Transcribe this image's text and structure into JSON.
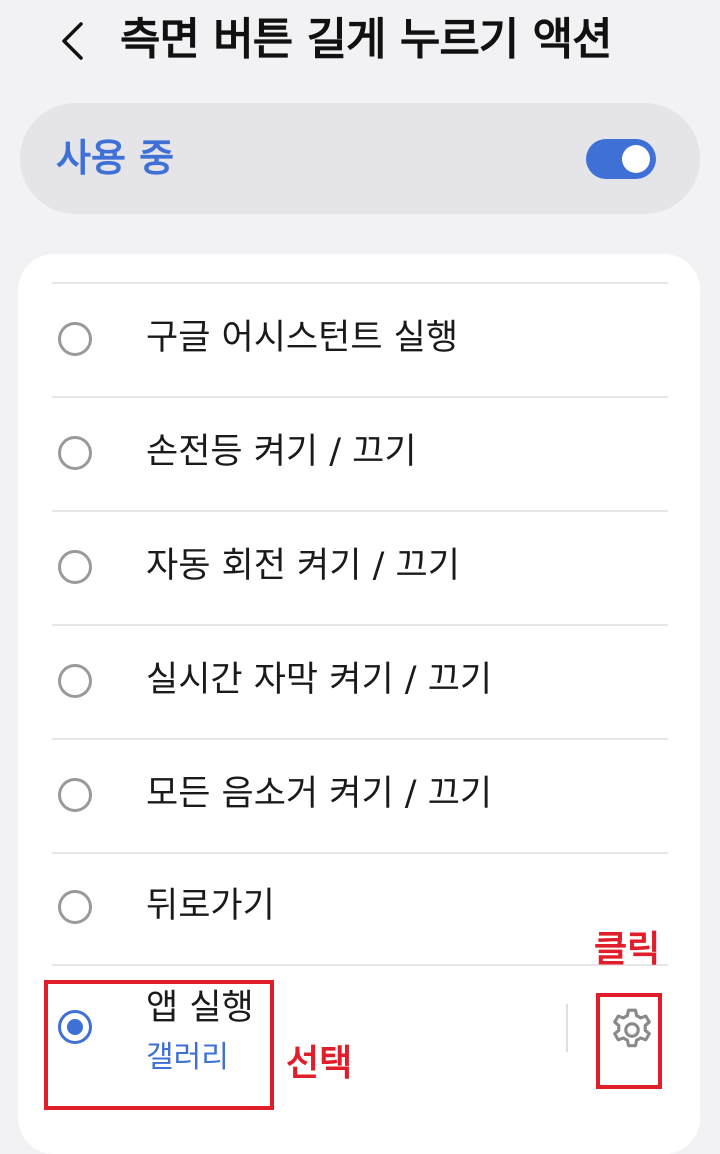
{
  "header": {
    "title": "측면 버튼 길게 누르기 액션",
    "back_icon": "chevron-left-icon"
  },
  "master_switch": {
    "label": "사용 중",
    "enabled": true,
    "accent_color": "#3e70d6"
  },
  "options": [
    {
      "label": "구글 어시스턴트 실행",
      "selected": false
    },
    {
      "label": "손전등 켜기 / 끄기",
      "selected": false
    },
    {
      "label": "자동 회전 켜기 / 끄기",
      "selected": false
    },
    {
      "label": "실시간 자막 켜기 / 끄기",
      "selected": false
    },
    {
      "label": "모든 음소거 켜기 / 끄기",
      "selected": false
    },
    {
      "label": "뒤로가기",
      "selected": false
    }
  ],
  "app_option": {
    "label": "앱 실행",
    "sublabel": "갤러리",
    "selected": true,
    "settings_icon": "gear-icon"
  },
  "annotations": {
    "select_label": "선택",
    "click_label": "클릭",
    "color": "#e11d2a"
  }
}
